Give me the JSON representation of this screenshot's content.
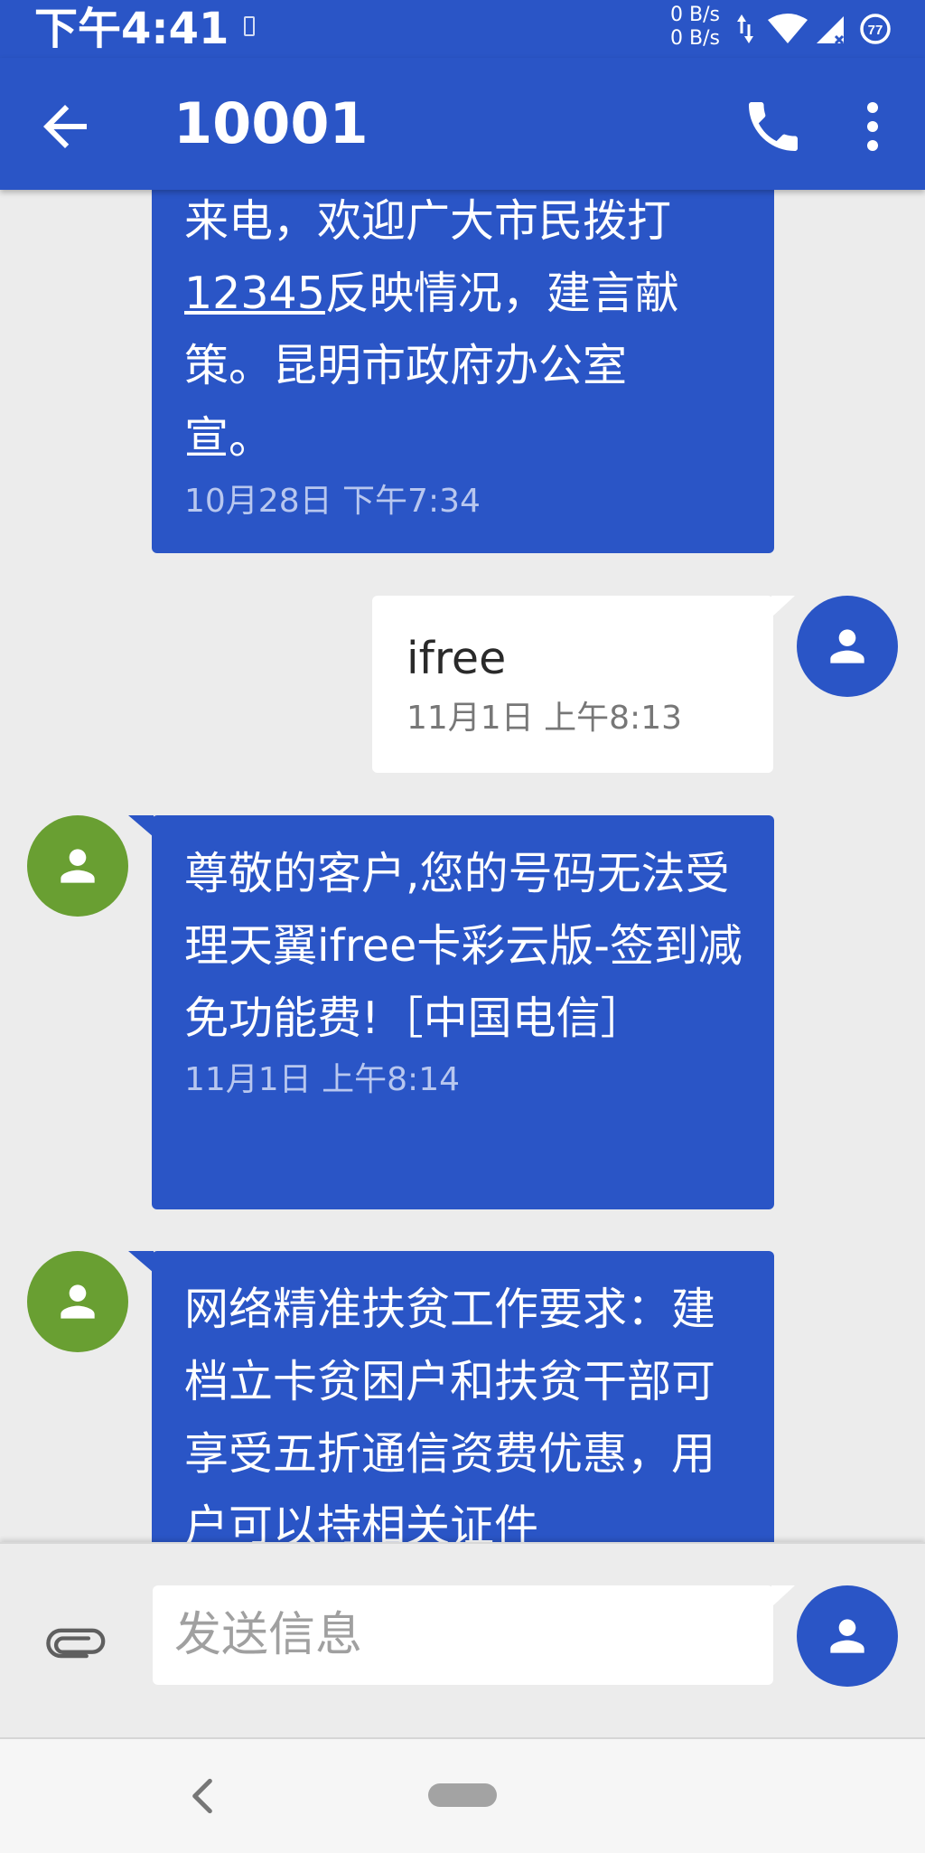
{
  "status_bar": {
    "time": "下午4:41",
    "net_up": "0 B/s",
    "net_down": "0 B/s",
    "battery": "77"
  },
  "app_bar": {
    "title": "10001"
  },
  "messages": [
    {
      "direction": "incoming",
      "lines": [
        "来电，欢迎广大市民拨打",
        "12345",
        "反映情况，建言献",
        "策。昆明市政府办公室",
        "宣。"
      ],
      "time": "10月28日 下午7:34"
    },
    {
      "direction": "outgoing",
      "text": "ifree",
      "time": "11月1日 上午8:13"
    },
    {
      "direction": "incoming",
      "text": "尊敬的客户,您的号码无法受理天翼ifree卡彩云版-签到减免功能费!［中国电信］",
      "time": "11月1日 上午8:14"
    },
    {
      "direction": "incoming",
      "text": "网络精准扶贫工作要求：建档立卡贫困户和扶贫干部可享受五折通信资费优惠，用户可以持相关证件"
    }
  ],
  "compose": {
    "placeholder": "发送信息"
  },
  "colors": {
    "primary": "#2a55c6",
    "contact_avatar": "#699f32",
    "background": "#ececec"
  },
  "icons": [
    "back-arrow-icon",
    "phone-icon",
    "more-vert-icon",
    "person-icon",
    "attach-icon",
    "nav-back-icon"
  ]
}
